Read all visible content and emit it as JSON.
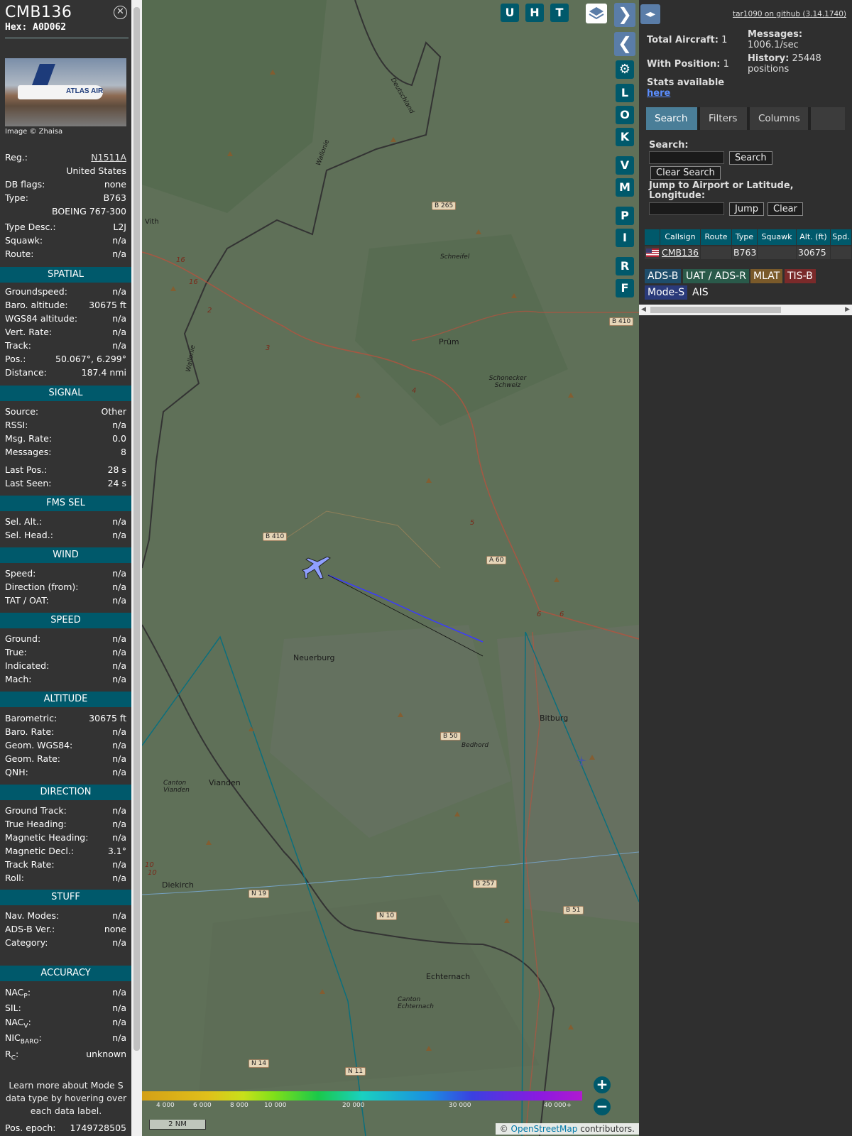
{
  "aircraft": {
    "callsign": "CMB136",
    "hex": "Hex: A0D062",
    "close_glyph": "✕",
    "photo_logo": "ATLAS AIR",
    "photo_credit": "Image © Zhaisa"
  },
  "details": [
    {
      "label": "Reg.:",
      "value": "N1511A"
    },
    {
      "label": "",
      "value": "United States"
    },
    {
      "label": "DB flags:",
      "value": "none"
    },
    {
      "label": "Type:",
      "value": "B763"
    },
    {
      "label": "",
      "value": "BOEING 767-300"
    },
    {
      "label": "Type Desc.:",
      "value": "L2J"
    },
    {
      "label": "Squawk:",
      "value": "n/a"
    },
    {
      "label": "Route:",
      "value": "n/a"
    }
  ],
  "sections": {
    "spatial": {
      "title": "SPATIAL",
      "rows": [
        {
          "label": "Groundspeed:",
          "value": "n/a"
        },
        {
          "label": "Baro. altitude:",
          "value": "30675 ft"
        },
        {
          "label": "WGS84 altitude:",
          "value": "n/a"
        },
        {
          "label": "Vert. Rate:",
          "value": "n/a"
        },
        {
          "label": "Track:",
          "value": "n/a"
        },
        {
          "label": "Pos.:",
          "value": "50.067°, 6.299°"
        },
        {
          "label": "Distance:",
          "value": "187.4 nmi"
        }
      ]
    },
    "signal": {
      "title": "SIGNAL",
      "rows": [
        {
          "label": "Source:",
          "value": "Other"
        },
        {
          "label": "RSSI:",
          "value": "n/a"
        },
        {
          "label": "Msg. Rate:",
          "value": "0.0"
        },
        {
          "label": "Messages:",
          "value": "8"
        },
        {
          "label": "Last Pos.:",
          "value": "28 s"
        },
        {
          "label": "Last Seen:",
          "value": "24 s"
        }
      ]
    },
    "fms": {
      "title": "FMS SEL",
      "rows": [
        {
          "label": "Sel. Alt.:",
          "value": "n/a"
        },
        {
          "label": "Sel. Head.:",
          "value": "n/a"
        }
      ]
    },
    "wind": {
      "title": "WIND",
      "rows": [
        {
          "label": "Speed:",
          "value": "n/a"
        },
        {
          "label": "Direction (from):",
          "value": "n/a"
        },
        {
          "label": "TAT / OAT:",
          "value": "n/a"
        }
      ]
    },
    "speed": {
      "title": "SPEED",
      "rows": [
        {
          "label": "Ground:",
          "value": "n/a"
        },
        {
          "label": "True:",
          "value": "n/a"
        },
        {
          "label": "Indicated:",
          "value": "n/a"
        },
        {
          "label": "Mach:",
          "value": "n/a"
        }
      ]
    },
    "altitude": {
      "title": "ALTITUDE",
      "rows": [
        {
          "label": "Barometric:",
          "value": "30675 ft"
        },
        {
          "label": "Baro. Rate:",
          "value": "n/a"
        },
        {
          "label": "Geom. WGS84:",
          "value": "n/a"
        },
        {
          "label": "Geom. Rate:",
          "value": "n/a"
        },
        {
          "label": "QNH:",
          "value": "n/a"
        }
      ]
    },
    "direction": {
      "title": "DIRECTION",
      "rows": [
        {
          "label": "Ground Track:",
          "value": "n/a"
        },
        {
          "label": "True Heading:",
          "value": "n/a"
        },
        {
          "label": "Magnetic Heading:",
          "value": "n/a"
        },
        {
          "label": "Magnetic Decl.:",
          "value": "3.1°"
        },
        {
          "label": "Track Rate:",
          "value": "n/a"
        },
        {
          "label": "Roll:",
          "value": "n/a"
        }
      ]
    },
    "stuff": {
      "title": "STUFF",
      "rows": [
        {
          "label": "Nav. Modes:",
          "value": "n/a"
        },
        {
          "label": "ADS-B Ver.:",
          "value": "none"
        },
        {
          "label": "Category:",
          "value": "n/a"
        }
      ]
    },
    "accuracy": {
      "title": "ACCURACY",
      "rows": [
        {
          "label": "NAC",
          "sub": "P",
          "value": "n/a"
        },
        {
          "label": "SIL:",
          "sub": "",
          "value": "n/a"
        },
        {
          "label": "NAC",
          "sub": "V",
          "value": "n/a"
        },
        {
          "label": "NIC",
          "sub": "BARO",
          "value": "n/a"
        },
        {
          "label": "R",
          "sub": "C",
          "value": "unknown"
        }
      ]
    }
  },
  "note": "Learn more about Mode S data type by hovering over each data label.",
  "pos_epoch": {
    "label": "Pos. epoch:",
    "value": "1749728505"
  },
  "map": {
    "buttons": [
      "U",
      "H",
      "T"
    ],
    "side_buttons": [
      "L",
      "O",
      "K",
      "V",
      "M",
      "P",
      "I",
      "R",
      "F"
    ],
    "nav_next": "❯",
    "nav_prev": "❮",
    "settings_glyph": "⚙",
    "places": [
      "Vith",
      "Schneifel",
      "Prüm",
      "Schonecker Schweiz",
      "Neuerburg",
      "Bitburg",
      "Bedhord",
      "Vianden",
      "Canton Vianden",
      "Diekirch",
      "Echternach",
      "Canton Echternach",
      "Deutschland",
      "Wallonie",
      "Wallonie"
    ],
    "roads": [
      "B 265",
      "B 410",
      "B 410",
      "A 60",
      "B 50",
      "B 257",
      "N 19",
      "N 10",
      "B 51",
      "N 14",
      "N 11"
    ],
    "road_numbers": [
      "16",
      "16",
      "2",
      "3",
      "4",
      "5",
      "6",
      "6",
      "10",
      "10"
    ],
    "zoom_in": "+",
    "zoom_out": "−",
    "scale": "2 NM",
    "attribution_prefix": "© ",
    "attribution_link": "OpenStreetMap",
    "attribution_suffix": " contributors.",
    "legend_ticks": [
      "4 000",
      "6 000",
      "8 000",
      "10 000",
      "20 000",
      "30 000",
      "40 000+"
    ],
    "colors": {
      "track": "#3a3aff",
      "ring": "#0b6f7d",
      "aircraft": "#8fa0ff"
    }
  },
  "panel": {
    "toggle_glyph": "◂▸",
    "github": "tar1090 on github (3.14.1740)",
    "total_aircraft_label": "Total Aircraft:",
    "total_aircraft": "1",
    "with_position_label": "With Position:",
    "with_position": "1",
    "messages_label": "Messages:",
    "messages_value": "1006.1/sec",
    "history_label": "History:",
    "history_value": "25448",
    "history_suffix": "positions",
    "stats_label": "Stats available",
    "stats_link": "here",
    "tabs": [
      "Search",
      "Filters",
      "Columns"
    ],
    "search_label": "Search:",
    "search_button": "Search",
    "clear_search": "Clear Search",
    "jump_label": "Jump to Airport or Latitude, Longitude:",
    "jump_button": "Jump",
    "clear_button": "Clear",
    "columns": [
      "Callsign",
      "Route",
      "Type",
      "Squawk",
      "Alt. (ft)",
      "Spd."
    ],
    "rows": [
      {
        "callsign": "CMB136",
        "route": "",
        "type": "B763",
        "squawk": "",
        "alt": "30675",
        "spd": ""
      }
    ],
    "source_tags": [
      {
        "label": "ADS-B",
        "color": "#1e4d6b"
      },
      {
        "label": "UAT / ADS-R",
        "color": "#2a5a4a"
      },
      {
        "label": "MLAT",
        "color": "#7a5a2a"
      },
      {
        "label": "TIS-B",
        "color": "#7a2a2a"
      },
      {
        "label": "Mode-S",
        "color": "#2a3a7a"
      },
      {
        "label": "AIS",
        "color": "#2f2f2f"
      }
    ]
  }
}
